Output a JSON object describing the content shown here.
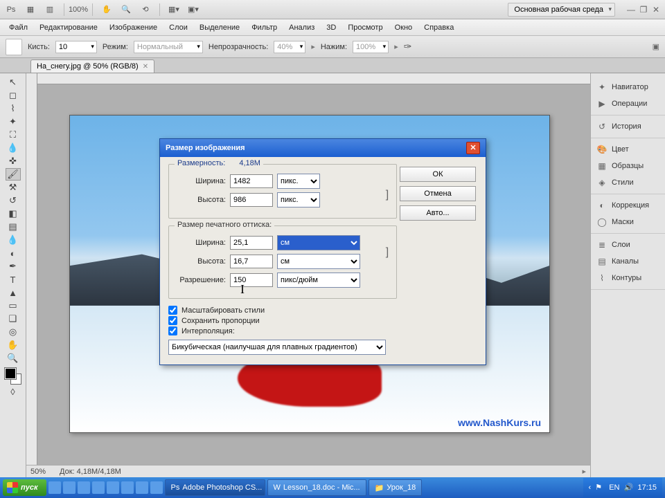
{
  "top": {
    "zoom": "100%",
    "workspace_label": "Основная рабочая среда"
  },
  "menu": {
    "file": "Файл",
    "edit": "Редактирование",
    "image": "Изображение",
    "layers": "Слои",
    "select": "Выделение",
    "filter": "Фильтр",
    "analysis": "Анализ",
    "3d": "3D",
    "view": "Просмотр",
    "window": "Окно",
    "help": "Справка"
  },
  "options": {
    "brush_label": "Кисть:",
    "brush_size": "10",
    "mode_label": "Режим:",
    "mode_value": "Нормальный",
    "opacity_label": "Непрозрачность:",
    "opacity_value": "40%",
    "flow_label": "Нажим:",
    "flow_value": "100%"
  },
  "tab": {
    "title": "На_снегу.jpg @ 50% (RGB/8)"
  },
  "status": {
    "zoom": "50%",
    "doc": "Док: 4,18М/4,18М"
  },
  "panels": {
    "navigator": "Навигатор",
    "actions": "Операции",
    "history": "История",
    "color": "Цвет",
    "swatches": "Образцы",
    "styles": "Стили",
    "adjustments": "Коррекция",
    "masks": "Маски",
    "layers": "Слои",
    "channels": "Каналы",
    "paths": "Контуры"
  },
  "dialog": {
    "title": "Размер изображения",
    "dim_legend": "Размерность:",
    "dim_value": "4,18М",
    "width_label": "Ширина:",
    "width_px": "1482",
    "height_label": "Высота:",
    "height_px": "986",
    "unit_px": "пикс.",
    "print_legend": "Размер печатного оттиска:",
    "width_cm": "25,1",
    "height_cm": "16,7",
    "unit_cm": "см",
    "res_label": "Разрешение:",
    "res_value": "150",
    "res_unit": "пикс/дюйм",
    "chk_scale": "Масштабировать стили",
    "chk_constrain": "Сохранить пропорции",
    "chk_resample": "Интерполяция:",
    "interp_method": "Бикубическая (наилучшая для плавных градиентов)",
    "btn_ok": "ОК",
    "btn_cancel": "Отмена",
    "btn_auto": "Авто..."
  },
  "watermark": "www.NashKurs.ru",
  "taskbar": {
    "start": "пуск",
    "task1": "Adobe Photoshop CS...",
    "task2": "Lesson_18.doc - Mic...",
    "task3": "Урок_18",
    "lang": "EN",
    "time": "17:15"
  }
}
